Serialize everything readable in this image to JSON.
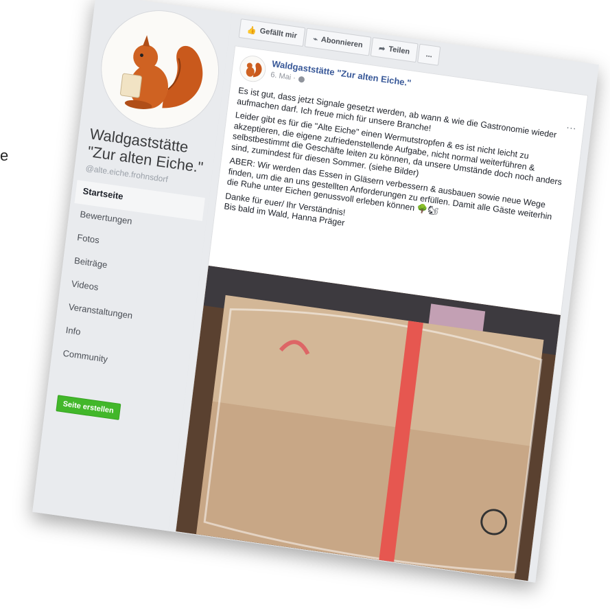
{
  "stray_text": "e",
  "sidebar": {
    "page_name": "Waldgaststätte \"Zur alten Eiche.\"",
    "page_handle": "@alte.eiche.frohnsdorf",
    "nav": [
      {
        "label": "Startseite",
        "active": true
      },
      {
        "label": "Bewertungen"
      },
      {
        "label": "Fotos"
      },
      {
        "label": "Beiträge"
      },
      {
        "label": "Videos"
      },
      {
        "label": "Veranstaltungen"
      },
      {
        "label": "Info"
      },
      {
        "label": "Community"
      }
    ],
    "create_page_label": "Seite erstellen"
  },
  "actionbar": {
    "like_label": "Gefällt mir",
    "like_icon": "thumbs-up-icon",
    "follow_label": "Abonnieren",
    "follow_icon": "rss-icon",
    "share_label": "Teilen",
    "share_icon": "share-arrow-icon",
    "more_label": "..."
  },
  "post": {
    "author": "Waldgaststätte \"Zur alten Eiche.\"",
    "date": "6. Mai ·",
    "more": "...",
    "paragraphs": [
      "Es ist gut, dass jetzt Signale gesetzt werden, ab wann & wie die Gastronomie wieder aufmachen darf. Ich freue mich für unsere Branche!",
      "Leider gibt es für die \"Alte Eiche\" einen Wermutstropfen & es ist nicht leicht zu akzeptieren, die eigene zufriedenstellende Aufgabe, nicht normal weiterführen & selbstbestimmt die Geschäfte leiten zu können, da unsere Umstände doch noch anders sind, zumindest für diesen Sommer. (siehe Bilder)",
      "ABER: Wir werden das Essen in Gläsern verbessern & ausbauen sowie neue Wege finden, um die an uns gestellten Anforderungen zu erfüllen. Damit alle Gäste weiterhin die Ruhe unter Eichen genussvoll erleben können 🌳🐿",
      "Danke für euer/ Ihr Verständnis!",
      "Bis bald im Wald, Hanna Präger"
    ]
  },
  "colors": {
    "link_blue": "#385898",
    "green_button": "#42b72a",
    "sidebar_bg": "#e9ebee",
    "squirrel_orange": "#c9591c",
    "tape_red": "#e23a32"
  }
}
